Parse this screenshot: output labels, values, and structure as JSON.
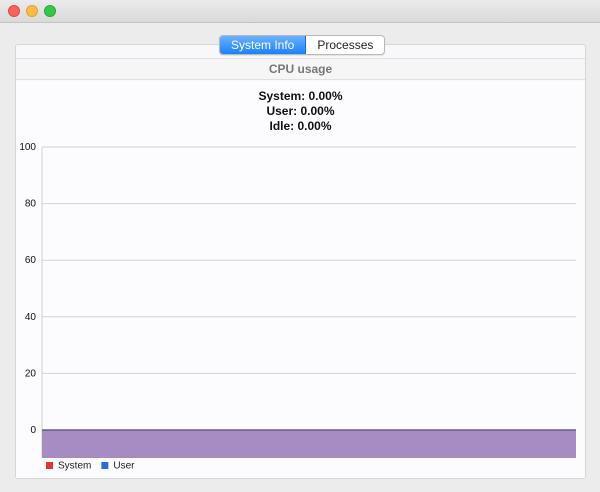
{
  "window": {
    "traffic_lights": [
      "close",
      "minimize",
      "maximize"
    ]
  },
  "tabs": [
    {
      "label": "System Info",
      "active": true
    },
    {
      "label": "Processes",
      "active": false
    }
  ],
  "section": {
    "title": "CPU usage"
  },
  "stats": {
    "system": "System: 0.00%",
    "user": "User: 0.00%",
    "idle": "Idle: 0.00%"
  },
  "chart_data": {
    "type": "area",
    "title": "",
    "xlabel": "",
    "ylabel": "",
    "ylim": [
      0,
      100
    ],
    "yticks": [
      0,
      20,
      40,
      60,
      80,
      100
    ],
    "grid": true,
    "legend_position": "bottom-left",
    "series": [
      {
        "name": "System",
        "color": "#e8312f",
        "values": [
          0,
          0
        ]
      },
      {
        "name": "User",
        "color": "#2a6fd6",
        "values": [
          0,
          0
        ]
      }
    ],
    "fill_color": "#a68cc3"
  }
}
